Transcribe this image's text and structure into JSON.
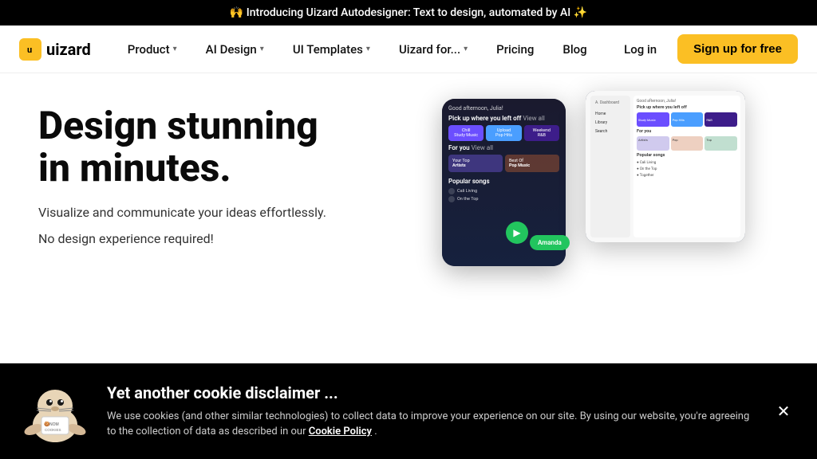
{
  "banner": {
    "text": "🙌 Introducing Uizard Autodesigner: Text to design, automated by AI ✨"
  },
  "navbar": {
    "logo_letter": "u",
    "logo_text": "uizard",
    "nav_items": [
      {
        "label": "Product",
        "has_dropdown": true
      },
      {
        "label": "AI Design",
        "has_dropdown": true
      },
      {
        "label": "UI Templates",
        "has_dropdown": true
      },
      {
        "label": "Uizard for...",
        "has_dropdown": true
      },
      {
        "label": "Pricing",
        "has_dropdown": false
      },
      {
        "label": "Blog",
        "has_dropdown": false
      }
    ],
    "login_label": "Log in",
    "signup_label": "Sign up for free"
  },
  "hero": {
    "title_line1": "Design stunning",
    "title_line2": "in minutes.",
    "desc1": "Visualize and communicate your ideas effortlessly.",
    "desc2": "No design experience required!",
    "chat_name": "Amanda"
  },
  "cookie": {
    "title": "Yet another cookie disclaimer ...",
    "text": "We use cookies (and other similar technologies) to collect data to improve your experience on our site. By using our website, you're agreeing to the collection of data as described in our ",
    "link_text": "Cookie Policy",
    "link_suffix": "."
  },
  "phone_screen": {
    "greeting": "Good afternoon, Julia!",
    "pickup_label": "Pick up where you left off",
    "view_all": "View all",
    "card1": "Chill Study Music",
    "card2": "Upload Pop Hits",
    "card3": "Weekend R&B",
    "for_you": "For you",
    "card_artists": "Your Top Artists",
    "card_pop": "Best Of Pop Music",
    "popular_songs": "Popular songs",
    "song1": "Cali Living",
    "song2": "On the Top"
  }
}
